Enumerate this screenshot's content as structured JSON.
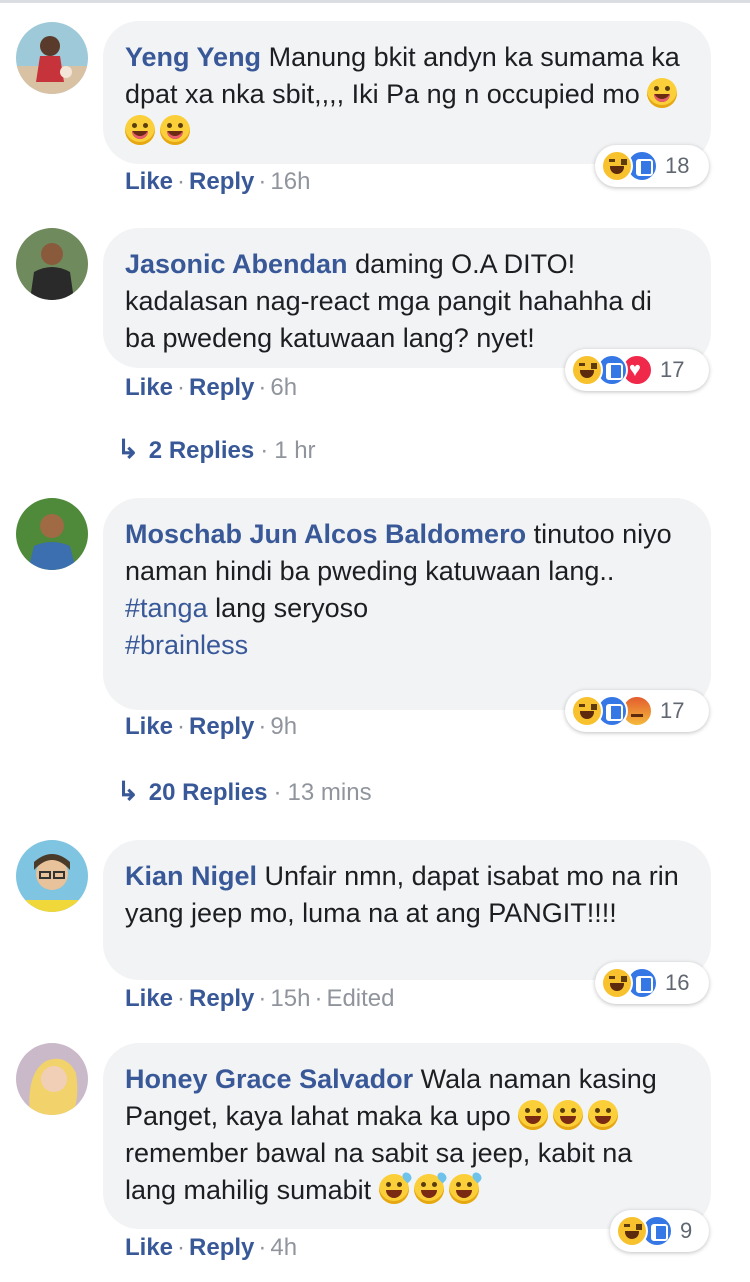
{
  "comments": [
    {
      "author": "Yeng Yeng",
      "text": "Manung bkit andyn ka sumama ka dpat xa nka sbit,,,, Iki Pa ng n occupied mo",
      "emoji_trail": [
        "tongue-emoji",
        "tongue-emoji",
        "tongue-emoji"
      ],
      "like": "Like",
      "reply": "Reply",
      "time": "16h",
      "reactions": [
        "haha",
        "like"
      ],
      "reaction_count": "18"
    },
    {
      "author": "Jasonic Abendan",
      "text": "daming O.A DITO! kadalasan nag-react mga pangit hahahha di ba pwedeng katuwaan lang? nyet!",
      "like": "Like",
      "reply": "Reply",
      "time": "6h",
      "reactions": [
        "haha",
        "like",
        "love"
      ],
      "reaction_count": "17",
      "replies": {
        "count": "2 Replies",
        "time": "1 hr"
      }
    },
    {
      "author": "Moschab Jun Alcos Baldomero",
      "text": "tinutoo niyo naman hindi ba pweding katuwaan lang..",
      "tags": [
        "#tanga",
        "#brainless"
      ],
      "tag_line_suffix": " lang seryoso",
      "like": "Like",
      "reply": "Reply",
      "time": "9h",
      "reactions": [
        "haha",
        "like",
        "angry"
      ],
      "reaction_count": "17",
      "replies": {
        "count": "20 Replies",
        "time": "13 mins"
      }
    },
    {
      "author": "Kian Nigel",
      "text": "Unfair nmn, dapat isabat mo na rin yang jeep mo, luma na at ang PANGIT!!!!",
      "like": "Like",
      "reply": "Reply",
      "time": "15h",
      "edited": "Edited",
      "reactions": [
        "haha",
        "like"
      ],
      "reaction_count": "16"
    },
    {
      "author": "Honey Grace Salvador",
      "text_part1": "Wala naman kasing Panget, kaya lahat maka ka upo",
      "text_part2": "remember bawal na sabit sa jeep, kabit na lang mahilig sumabit",
      "like": "Like",
      "reply": "Reply",
      "time": "4h",
      "reactions": [
        "haha",
        "like"
      ],
      "reaction_count": "9"
    }
  ],
  "colors": {
    "link": "#385898",
    "bubble": "#f2f3f5",
    "meta_grey": "#90949c"
  }
}
